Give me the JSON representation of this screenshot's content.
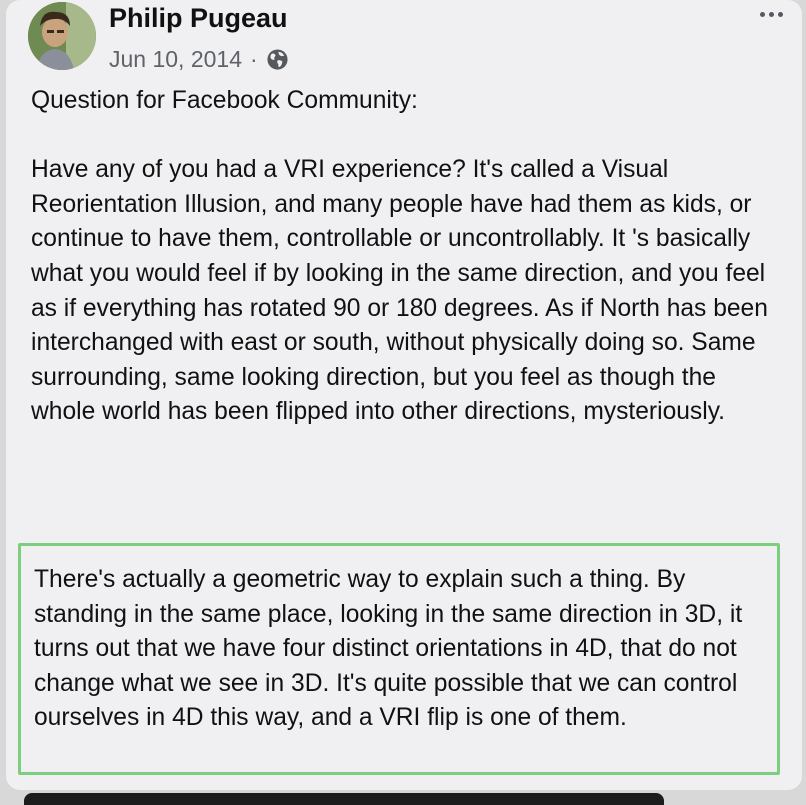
{
  "post": {
    "author": "Philip Pugeau",
    "date": "Jun 10, 2014",
    "separator": "·",
    "privacy_icon": "globe-icon",
    "more_icon": "more-horizontal-icon",
    "paragraphs": [
      "Question for Facebook Community:",
      "Have any of you had a VRI experience? It's called a Visual Reorientation Illusion, and many people have had them as kids, or continue to have them, controllable or uncontrollably. It 's basically what you would feel if by looking in the same direction, and you feel as if everything has rotated 90 or 180 degrees. As if North has been interchanged with east or south, without physically doing so. Same surrounding, same looking direction, but you feel as though the whole world has been flipped into other directions, mysteriously."
    ],
    "highlighted_paragraph": "There's actually a geometric way to explain such a thing. By standing in the same place, looking in the same direction in 3D, it turns out that we have four distinct orientations in 4D, that do not change what we see in 3D. It's quite possible that we can control ourselves in 4D this way, and a VRI flip is one of them."
  },
  "colors": {
    "card_background": "#f0f0f2",
    "highlight_border": "#7dcf7d",
    "meta_text": "#5f6368"
  }
}
